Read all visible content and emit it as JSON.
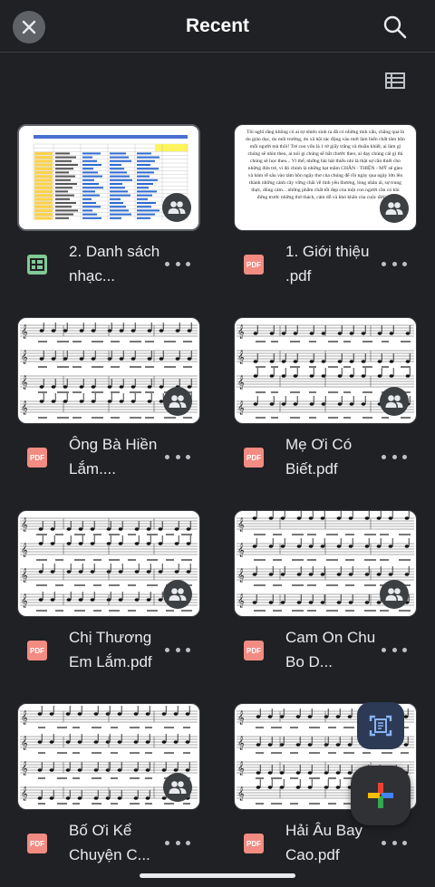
{
  "header": {
    "title": "Recent"
  },
  "icons": {
    "close": "close-icon",
    "search": "search-icon",
    "view_toggle": "list-view-icon",
    "more": "more-horiz-icon",
    "shared": "people-icon",
    "scan": "document-scanner-icon",
    "new": "plus-icon"
  },
  "files": [
    {
      "name": "2. Danh sách nhạc...",
      "type": "sheet",
      "icon_label": "",
      "thumb": "spreadsheet",
      "shared": true
    },
    {
      "name": "1. Giới thiệu .pdf",
      "type": "pdf",
      "icon_label": "PDF",
      "thumb": "text",
      "shared": true,
      "thumb_text": "Tôi nghĩ rằng không có ai tự nhiên sinh ra đã có những tính xấu, chẳng qua là do giáo dục, do môi trường, do xã hội tác động vào mới làm biến chất tâm hồn mỗi người mà thôi! Trẻ con vốn là 1 tờ giấy trắng và thuần khiết, ai làm gì chúng sẽ nhìn theo, ai nói gì chúng sẽ bắt chước theo, ai dạy chúng cái gì thì chúng sẽ học theo... Vì thế, những bài hát thiếu nhi là thật sự cần thiết cho những đứa trẻ, vì đó chính là những hạt mầm CHÂN - THIỆN - MỸ sẽ gieo và bám rễ sâu vào tâm hồn ngây thơ của chúng để rồi ngày qua ngày lớn lên thành những cánh cây vững chãi về tình yêu thương, lòng nhân ái, sự trung thực, dũng cảm... những phẩm chất tốt đẹp của một con người cần có khi đứng trước những thử thách, cám dỗ và khó khăn của cuộc đời! Đó"
    },
    {
      "name": "Ông Bà Hiền Lắm....",
      "type": "pdf",
      "icon_label": "PDF",
      "thumb": "music",
      "shared": true
    },
    {
      "name": "Mẹ Ơi Có Biết.pdf",
      "type": "pdf",
      "icon_label": "PDF",
      "thumb": "music",
      "shared": true
    },
    {
      "name": "Chị Thương Em Lắm.pdf",
      "type": "pdf",
      "icon_label": "PDF",
      "thumb": "music",
      "shared": true
    },
    {
      "name": "Cam On Chu Bo D...",
      "type": "pdf",
      "icon_label": "PDF",
      "thumb": "music",
      "shared": true
    },
    {
      "name": "Bố Ơi Kể Chuyện C...",
      "type": "pdf",
      "icon_label": "PDF",
      "thumb": "music",
      "shared": true
    },
    {
      "name": "Hải Âu Bay Cao.pdf",
      "type": "pdf",
      "icon_label": "PDF",
      "thumb": "music",
      "shared": false
    }
  ],
  "colors": {
    "background": "#202124",
    "pdf_red": "#f28b82",
    "sheet_green": "#81c995",
    "scan_fab": "#2d3a55",
    "scan_icon": "#8ab4f8"
  }
}
